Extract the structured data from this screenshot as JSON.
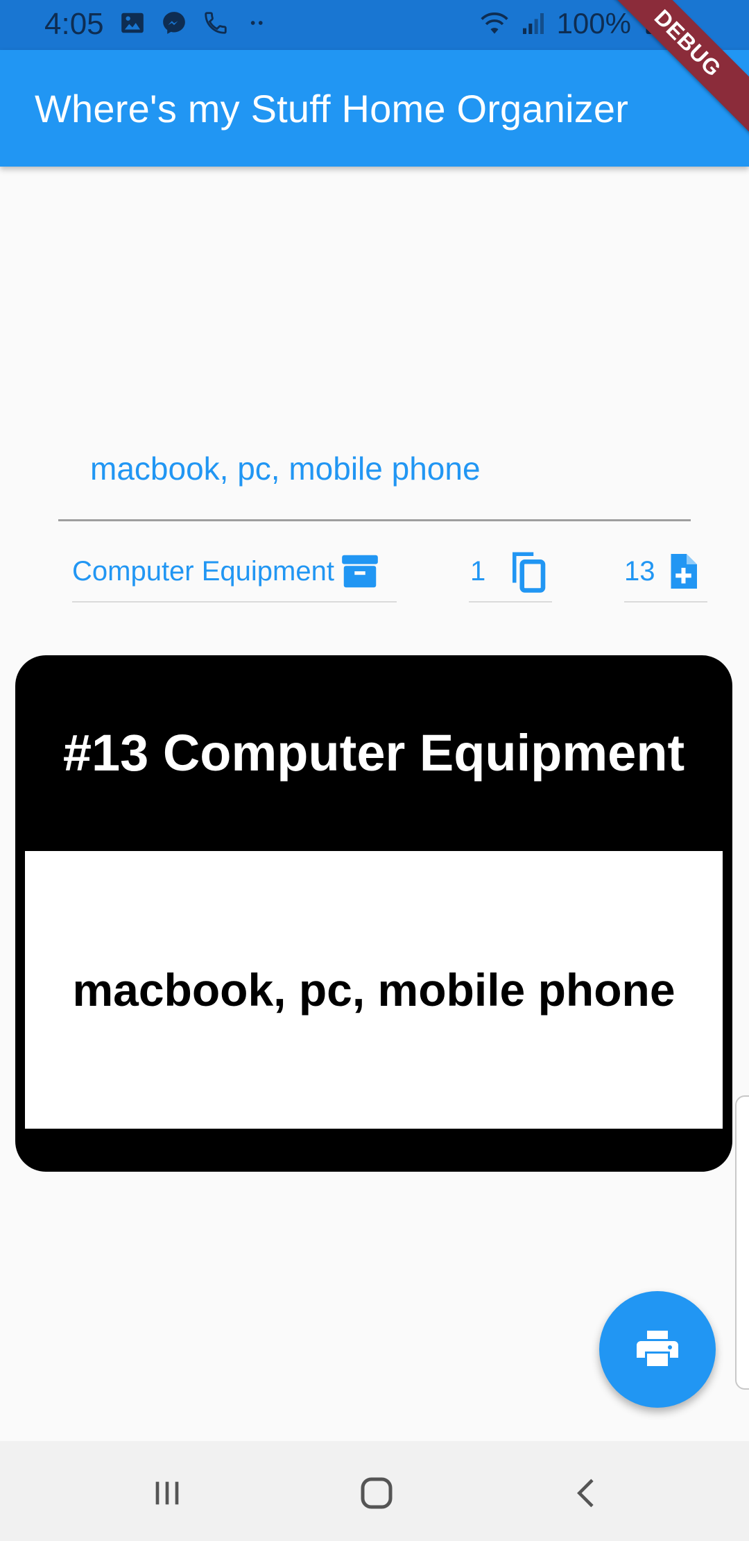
{
  "status_bar": {
    "time": "4:05",
    "battery": "100%",
    "left_icons": [
      "image-icon",
      "messenger-icon",
      "call-icon",
      "more-dots-icon"
    ],
    "right_icons": [
      "wifi-icon",
      "signal-icon",
      "battery-icon"
    ]
  },
  "app_bar": {
    "title": "Where's my Stuff Home Organizer",
    "debug_banner": "DEBUG"
  },
  "form": {
    "items_value": "macbook, pc, mobile phone",
    "category_value": "Computer Equipment",
    "copies_value": "1",
    "box_number_value": "13",
    "icons": [
      "archive-icon",
      "copy-icon",
      "note-add-icon"
    ]
  },
  "label_preview": {
    "title": "#13 Computer Equipment",
    "body": "macbook, pc, mobile phone"
  },
  "fab": {
    "icon": "print-icon"
  },
  "nav": {
    "icons": [
      "recents-icon",
      "home-icon",
      "back-icon"
    ]
  },
  "colors": {
    "primary": "#2196F3",
    "status_bar": "#1976D2",
    "debug": "#8B2C3A",
    "background": "#FAFAFA"
  }
}
